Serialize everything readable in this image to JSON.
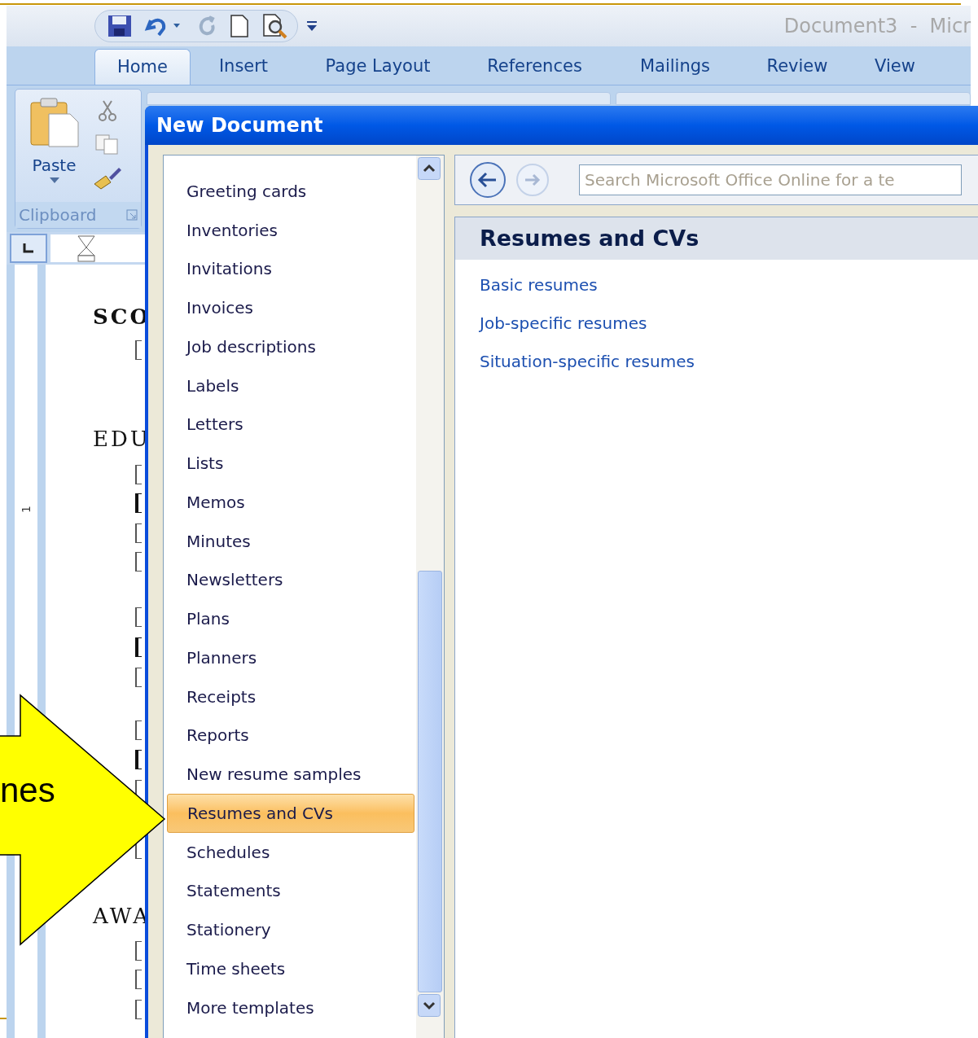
{
  "window": {
    "title": "Document3  -  Micr"
  },
  "tabs": [
    {
      "label": "Home",
      "selected": true
    },
    {
      "label": "Insert",
      "selected": false
    },
    {
      "label": "Page Layout",
      "selected": false
    },
    {
      "label": "References",
      "selected": false
    },
    {
      "label": "Mailings",
      "selected": false
    },
    {
      "label": "Review",
      "selected": false
    },
    {
      "label": "View",
      "selected": false
    }
  ],
  "clipboard": {
    "paste_label": "Paste",
    "group_label": "Clipboard"
  },
  "ruler": {
    "mark": "1"
  },
  "document": {
    "lines": [
      "SCO",
      "EDU",
      "AWA"
    ]
  },
  "dialog": {
    "title": "New Document",
    "categories": [
      {
        "label": "Greeting cards",
        "selected": false
      },
      {
        "label": "Inventories",
        "selected": false
      },
      {
        "label": "Invitations",
        "selected": false
      },
      {
        "label": "Invoices",
        "selected": false
      },
      {
        "label": "Job descriptions",
        "selected": false
      },
      {
        "label": "Labels",
        "selected": false
      },
      {
        "label": "Letters",
        "selected": false
      },
      {
        "label": "Lists",
        "selected": false
      },
      {
        "label": "Memos",
        "selected": false
      },
      {
        "label": "Minutes",
        "selected": false
      },
      {
        "label": "Newsletters",
        "selected": false
      },
      {
        "label": "Plans",
        "selected": false
      },
      {
        "label": "Planners",
        "selected": false
      },
      {
        "label": "Receipts",
        "selected": false
      },
      {
        "label": "Reports",
        "selected": false
      },
      {
        "label": "New resume samples",
        "selected": false
      },
      {
        "label": "Resumes and CVs",
        "selected": true
      },
      {
        "label": "Schedules",
        "selected": false
      },
      {
        "label": "Statements",
        "selected": false
      },
      {
        "label": "Stationery",
        "selected": false
      },
      {
        "label": "Time sheets",
        "selected": false
      },
      {
        "label": "More templates",
        "selected": false
      }
    ],
    "search": {
      "placeholder": "Search Microsoft Office Online for a te"
    },
    "heading": "Resumes and CVs",
    "links": [
      "Basic resumes",
      "Job-specific resumes",
      "Situation-specific resumes"
    ]
  },
  "callout": {
    "text": "nes"
  }
}
